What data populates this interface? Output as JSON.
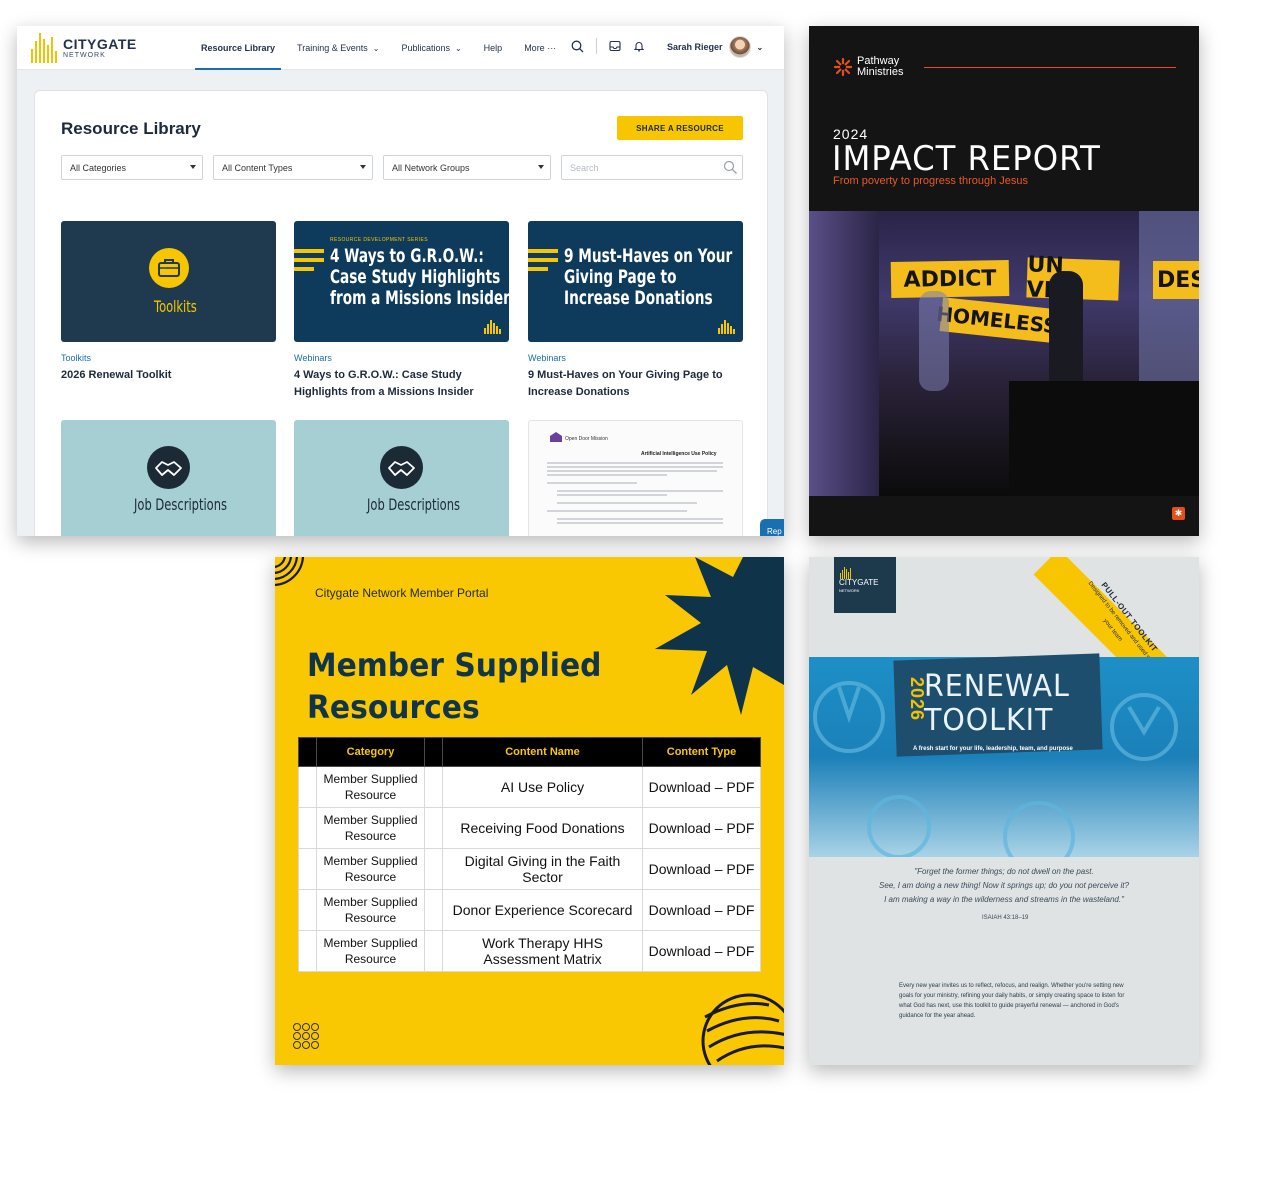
{
  "portal": {
    "logo": {
      "name": "CITYGATE",
      "sub": "NETWORK"
    },
    "nav": [
      {
        "label": "Resource Library",
        "has_chevron": false
      },
      {
        "label": "Training & Events",
        "has_chevron": true
      },
      {
        "label": "Publications",
        "has_chevron": true
      },
      {
        "label": "Help",
        "has_chevron": false
      },
      {
        "label": "More ···",
        "has_chevron": false
      }
    ],
    "user_name": "Sarah Rieger",
    "page_title": "Resource Library",
    "share_label": "SHARE A RESOURCE",
    "filters": [
      "All Categories",
      "All Content Types",
      "All Network Groups"
    ],
    "search_placeholder": "Search",
    "cards": [
      {
        "thumb_text": "Toolkits",
        "category": "Toolkits",
        "title": "2026 Renewal Toolkit"
      },
      {
        "thumb_kicker": "RESOURCE DEVELOPMENT SERIES",
        "thumb_lines": [
          "4 Ways to G.R.O.W.:",
          "Case Study Highlights",
          "from a Missions Insider"
        ],
        "category": "Webinars",
        "title": "4 Ways to G.R.O.W.: Case Study Highlights from a Missions Insider"
      },
      {
        "thumb_lines": [
          "9 Must-Haves on Your",
          "Giving Page to",
          "Increase Donations"
        ],
        "category": "Webinars",
        "title": "9 Must-Haves on Your Giving Page to Increase Donations"
      },
      {
        "thumb_text": "Job Descriptions"
      },
      {
        "thumb_text": "Job Descriptions"
      },
      {
        "doc_org": "Open Door Mission",
        "doc_title": "Artificial Intelligence Use Policy"
      }
    ],
    "feedback_label": "Rep",
    "colors": {
      "accent": "#f7c600",
      "link": "#1a6fb0",
      "navy": "#0e3b5b"
    }
  },
  "impact": {
    "org": [
      "Pathway",
      "Ministries"
    ],
    "year": "2024",
    "title": "IMPACT REPORT",
    "subtitle": "From poverty to progress through Jesus",
    "signs": [
      "ADDICT",
      "UN  VED",
      "DESP",
      "HOMELESS"
    ]
  },
  "member": {
    "portal_label": "Citygate Network Member Portal",
    "title_lines": [
      "Member Supplied",
      "Resources"
    ],
    "headers": [
      "Category",
      "Content Name",
      "Content Type"
    ],
    "rows": [
      {
        "category": "Member Supplied Resource",
        "name": "AI Use Policy",
        "type": "Download – PDF"
      },
      {
        "category": "Member Supplied Resource",
        "name": "Receiving Food Donations",
        "type": "Download – PDF"
      },
      {
        "category": "Member Supplied Resource",
        "name": "Digital Giving in the Faith Sector",
        "type": "Download – PDF"
      },
      {
        "category": "Member Supplied Resource",
        "name": "Donor Experience Scorecard",
        "type": "Download – PDF"
      },
      {
        "category": "Member Supplied Resource",
        "name": "Work Therapy HHS Assessment Matrix",
        "type": "Download – PDF"
      }
    ]
  },
  "renewal": {
    "logo": [
      "CITYGATE",
      "NETWORK"
    ],
    "ribbon_title": "PULL-OUT TOOLKIT",
    "ribbon_sub": "Designed to be removed and used with your team",
    "year": "2026",
    "title_lines": [
      "RENEWAL",
      "TOOLKIT"
    ],
    "tagline": "A fresh start for your life, leadership, team, and purpose",
    "verse_lines": [
      "\"Forget the former things; do not dwell on the past.",
      "See, I am doing a new thing! Now it springs up; do you not perceive it?",
      "I am making a way in the wilderness and streams in the wasteland.\""
    ],
    "verse_ref": "ISAIAH 43:18–19",
    "body": "Every new year invites us to reflect, refocus, and realign. Whether you're setting new goals for your ministry, refining your daily habits, or simply creating space to listen for what God has next, use this toolkit to guide prayerful renewal — anchored in God's guidance for the year ahead."
  }
}
